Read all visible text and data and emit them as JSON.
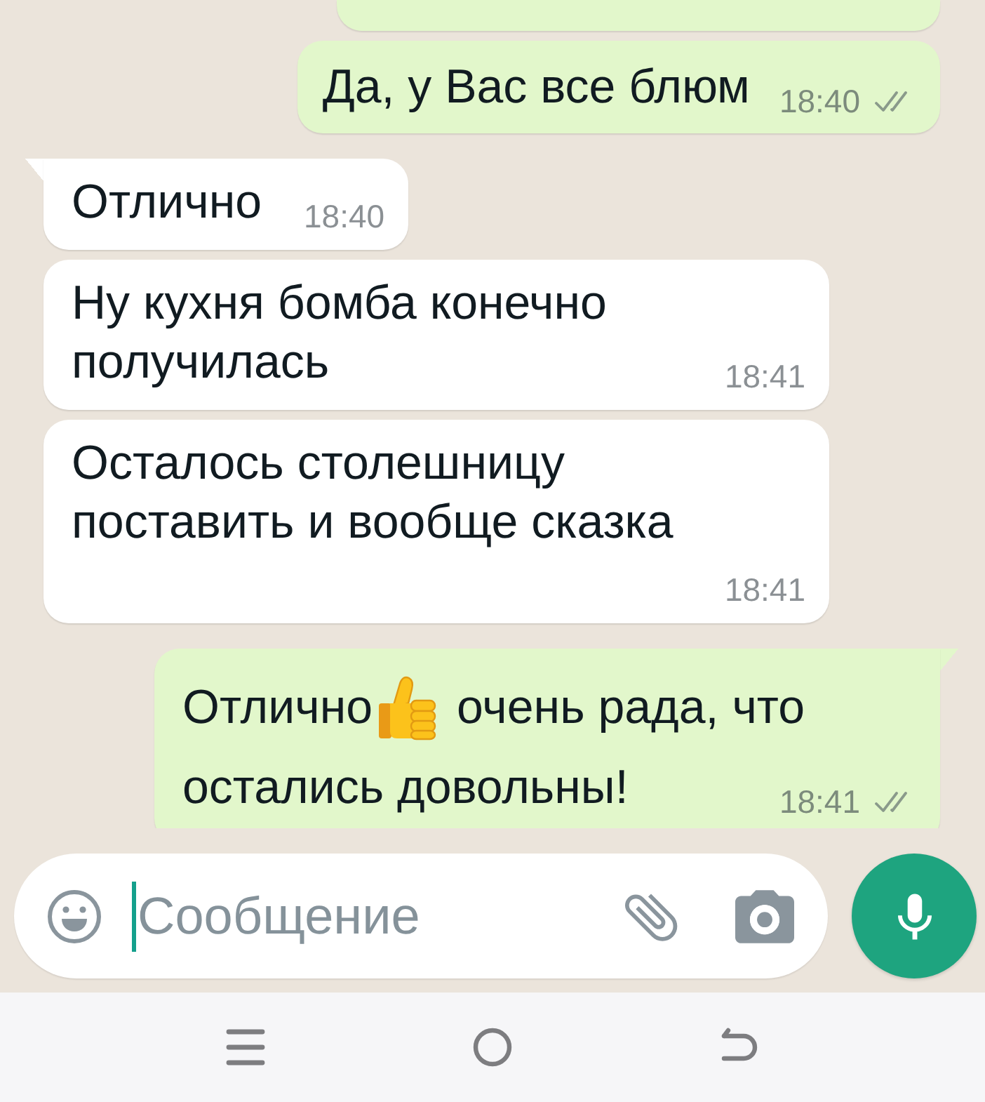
{
  "chat": {
    "messages": [
      {
        "kind": "cut-off",
        "outgoing": true,
        "tail": false
      },
      {
        "kind": "text",
        "outgoing": true,
        "tail": false,
        "text": "Да, у Вас все блюм",
        "time": "18:40",
        "read": false
      },
      {
        "kind": "text",
        "outgoing": false,
        "tail": true,
        "text": "Отлично",
        "time": "18:40"
      },
      {
        "kind": "text",
        "outgoing": false,
        "tail": false,
        "text": "Ну кухня бомба конечно получилась",
        "time": "18:41"
      },
      {
        "kind": "text",
        "outgoing": false,
        "tail": false,
        "text": "Осталось столешницу поставить и вообще сказка",
        "time": "18:41"
      },
      {
        "kind": "rich",
        "outgoing": true,
        "tail": true,
        "lines": [
          [
            {
              "kind": "text",
              "text": "Отлично"
            },
            {
              "kind": "emoji"
            },
            {
              "kind": "text",
              "text": "очень рада, что"
            }
          ],
          [
            {
              "kind": "text",
              "text": "остались довольны!"
            }
          ]
        ],
        "time": "18:41",
        "read": false
      }
    ]
  },
  "composer": {
    "placeholder": "Сообщение"
  }
}
